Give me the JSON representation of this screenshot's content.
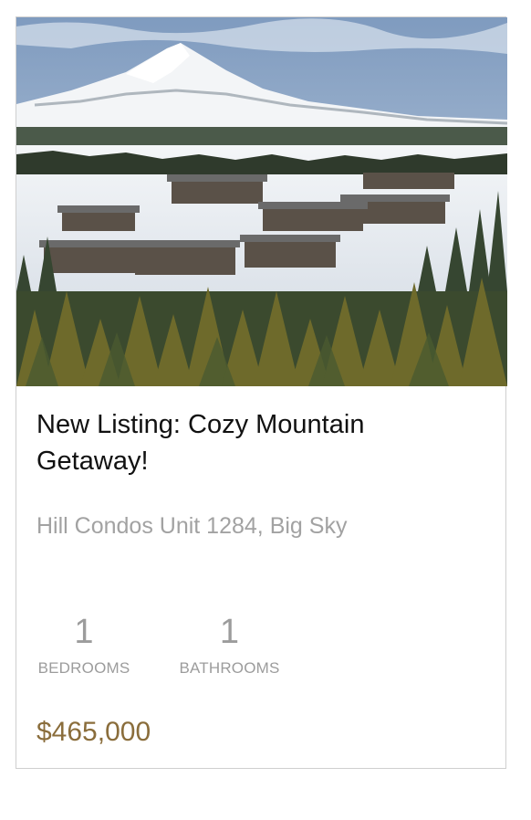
{
  "listing": {
    "image_alt": "Aerial view of snowy mountain condos with pine forest",
    "title": "New Listing: Cozy Mountain Getaway!",
    "address": "Hill Condos Unit 1284, Big Sky",
    "stats": {
      "bedrooms_value": "1",
      "bedrooms_label": "BEDROOMS",
      "bathrooms_value": "1",
      "bathrooms_label": "BATHROOMS"
    },
    "price": "$465,000",
    "colors": {
      "price": "#8a6d3b",
      "muted": "#9c9c9c",
      "border": "#cfcfcf"
    }
  }
}
